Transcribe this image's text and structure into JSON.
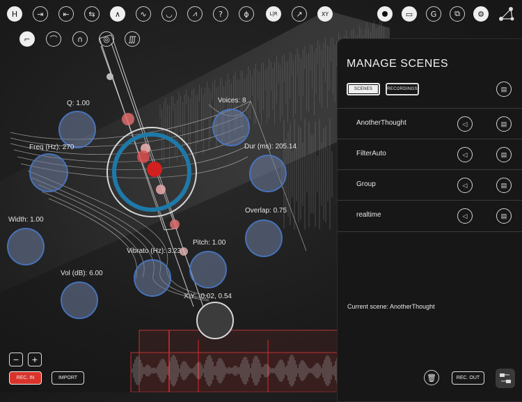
{
  "toolbar": {
    "top_left_icons": [
      "H",
      "⇥",
      "⇤",
      "⇆",
      "∧",
      "∿",
      "◡",
      "⩘",
      "?",
      "ϕ",
      "L|R",
      "↗",
      "XY"
    ],
    "filter_icons": [
      "highpass-icon",
      "lowpass-icon",
      "bandpass-icon",
      "compass-icon",
      "waveform-icon"
    ],
    "right_icons": [
      "record-icon",
      "folder-icon",
      "g-icon",
      "layers-icon",
      "settings-icon",
      "share-icon"
    ]
  },
  "knobs": {
    "q": "Q: 1.00",
    "voices": "Voices: 8",
    "freq": "Freq (Hz): 270",
    "dur": "Dur (ms): 205.14",
    "width": "Width: 1.00",
    "overlap": "Overlap: 0.75",
    "vibrato": "Vibrato (Hz): 3.23",
    "pitch": "Pitch: 1.00",
    "vol": "Vol (dB): 6.00",
    "xy": "X,Y: -0.02, 0.54"
  },
  "panel": {
    "title": "MANAGE SCENES",
    "scenes_tab": "SCENES",
    "recordings_tab": "RECORDINGS",
    "scenes": [
      "AnotherThought",
      "FilterAuto",
      "Group",
      "realtime"
    ],
    "current_scene_label": "Current scene:",
    "current_scene": "AnotherThought"
  },
  "bottom": {
    "minus": "−",
    "plus": "+",
    "rec_in": "REC. IN",
    "import": "IMPORT",
    "rec_out": "REC. OUT",
    "rec_in_color": "#d9342b"
  }
}
